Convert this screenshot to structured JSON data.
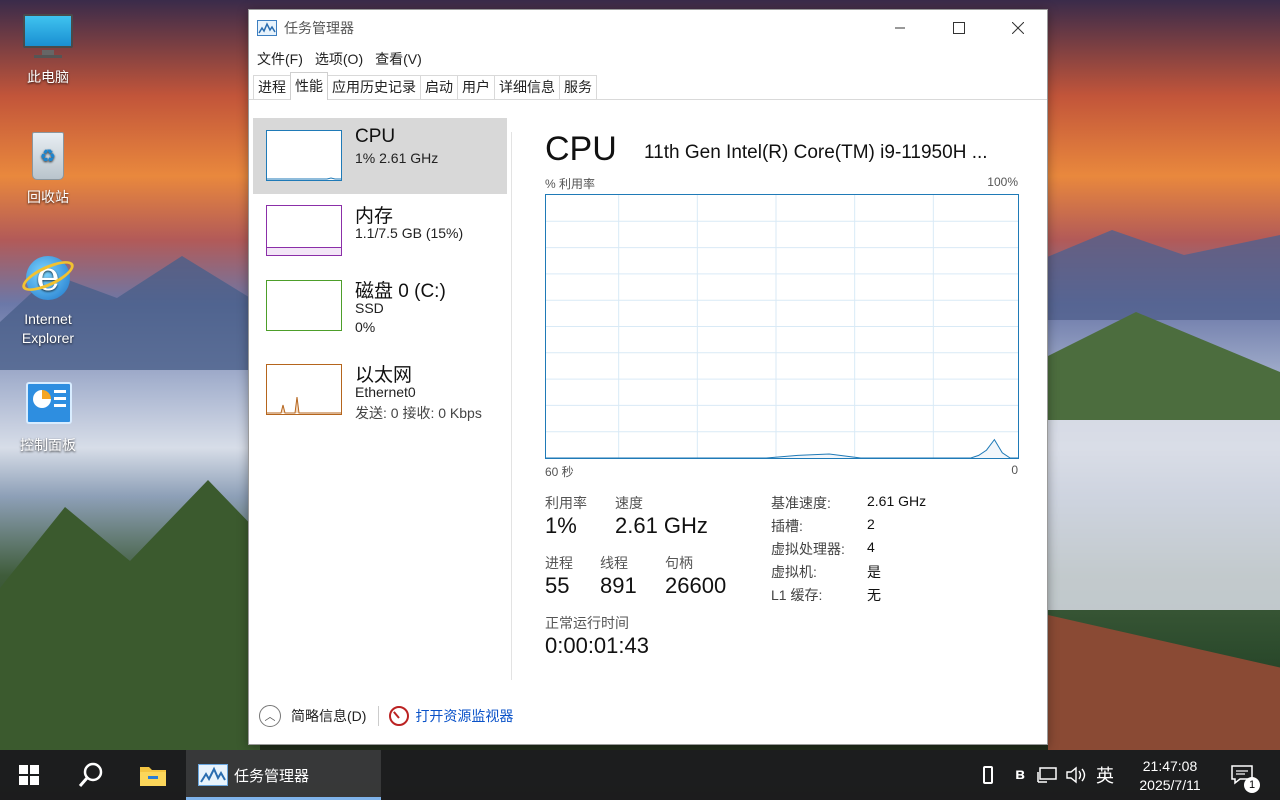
{
  "desktop": {
    "icons": [
      {
        "label": "此电脑"
      },
      {
        "label": "回收站"
      },
      {
        "label_line1": "Internet",
        "label_line2": "Explorer"
      },
      {
        "label": "控制面板"
      }
    ]
  },
  "window": {
    "title": "任务管理器",
    "menu": [
      "文件(F)",
      "选项(O)",
      "查看(V)"
    ],
    "tabs": [
      "进程",
      "性能",
      "应用历史记录",
      "启动",
      "用户",
      "详细信息",
      "服务"
    ],
    "active_tab": "性能",
    "colors": {
      "cpu": "#1f7ab7",
      "memory": "#8b2fa8",
      "disk": "#4d9e2a",
      "network": "#b5651d"
    }
  },
  "sidebar": {
    "items": [
      {
        "name": "CPU",
        "line1": "1% 2.61 GHz"
      },
      {
        "name": "内存",
        "line1": "1.1/7.5 GB (15%)"
      },
      {
        "name": "磁盘 0 (C:)",
        "line1": "SSD",
        "line2": "0%"
      },
      {
        "name": "以太网",
        "line1": "Ethernet0",
        "line2": "发送: 0 接收: 0 Kbps"
      }
    ]
  },
  "cpu_panel": {
    "title": "CPU",
    "model": "11th Gen Intel(R) Core(TM) i9-11950H ...",
    "graph_label_left": "% 利用率",
    "graph_label_right": "100%",
    "graph_bottom_left": "60 秒",
    "graph_bottom_right": "0",
    "stats": {
      "utilization_label": "利用率",
      "utilization": "1%",
      "speed_label": "速度",
      "speed": "2.61 GHz",
      "processes_label": "进程",
      "processes": "55",
      "threads_label": "线程",
      "threads": "891",
      "handles_label": "句柄",
      "handles": "26600",
      "uptime_label": "正常运行时间",
      "uptime": "0:00:01:43"
    },
    "specs": [
      {
        "label": "基准速度:",
        "value": "2.61 GHz"
      },
      {
        "label": "插槽:",
        "value": "2"
      },
      {
        "label": "虚拟处理器:",
        "value": "4"
      },
      {
        "label": "虚拟机:",
        "value": "是"
      },
      {
        "label": "L1 缓存:",
        "value": "无"
      }
    ]
  },
  "chart_data": {
    "type": "line",
    "x": [
      60,
      56,
      52,
      48,
      44,
      40,
      36,
      32,
      28,
      24,
      20,
      16,
      12,
      8,
      6,
      5,
      4,
      3,
      2,
      1,
      0
    ],
    "series": [
      {
        "values": [
          0,
          0,
          0,
          0,
          0,
          0,
          0,
          0,
          1,
          1.5,
          0,
          0,
          0,
          0,
          0,
          1,
          3,
          7,
          2,
          0,
          0
        ]
      }
    ],
    "xlabel": "60 秒",
    "ylabel": "% 利用率",
    "ylim": [
      0,
      100
    ],
    "grid": true
  },
  "footer": {
    "summary": "简略信息(D)",
    "link": "打开资源监视器"
  },
  "taskbar": {
    "app_label": "任务管理器",
    "ime": "英",
    "time": "21:47:08",
    "date": "2025/7/11",
    "notification_count": "1"
  }
}
